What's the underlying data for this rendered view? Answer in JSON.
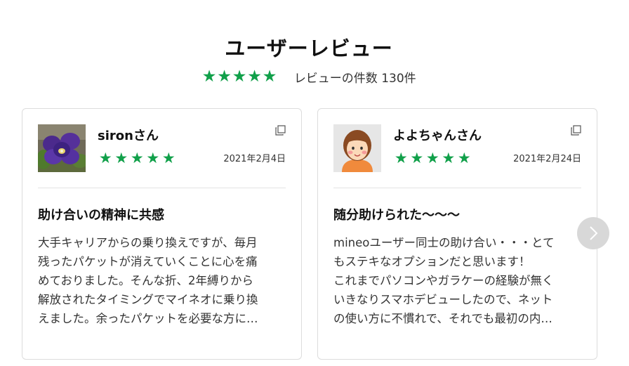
{
  "header": {
    "title": "ユーザーレビュー",
    "rating": 5,
    "review_count_label": "レビューの件数 130件"
  },
  "colors": {
    "star": "#11a04a",
    "border": "#dcdcdc",
    "next_button": "#d8d8d8"
  },
  "reviews": [
    {
      "user": "sironさん",
      "rating": 5,
      "date": "2021年2月4日",
      "avatar_icon": "pansy-flower-photo",
      "title": "助け合いの精神に共感",
      "body_lines": [
        "大手キャリアからの乗り換えですが、毎月",
        "残ったパケットが消えていくことに心を痛",
        "めておりました。そんな折、2年縛りから",
        "解放されたタイミングでマイネオに乗り換",
        "えました。余ったパケットを必要な方に…"
      ]
    },
    {
      "user": "よよちゃんさん",
      "rating": 5,
      "date": "2021年2月24日",
      "avatar_icon": "woman-illustration",
      "title": "随分助けられた～～～",
      "body_lines": [
        "mineoユーザー同士の助け合い・・・とて",
        "もステキなオプションだと思います！",
        "これまでパソコンやガラケーの経験が無く",
        "いきなりスマホデビューしたので、ネット",
        "の使い方に不慣れで、それでも最初の内…"
      ]
    }
  ],
  "icons": {
    "copy": "copy-icon",
    "next": "chevron-right-icon"
  }
}
